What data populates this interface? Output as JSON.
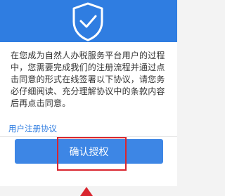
{
  "dialog": {
    "body_text": "在您成为自然人办税服务平台用户的过程中，您需要完成我们的注册流程并通过点击同意的形式在线签署以下协议，请您务必仔细阅读、充分理解协议中的条款内容后再点击同意。",
    "agreement_link": "用户注册协议",
    "authorize_button": "确认授权"
  },
  "icons": {
    "banner": "shield-check-icon",
    "annotation": "arrow-up-icon"
  },
  "colors": {
    "banner": "#2f7de1",
    "button": "#3d86e5",
    "link": "#2f7de1",
    "highlight": "#d9252e"
  }
}
